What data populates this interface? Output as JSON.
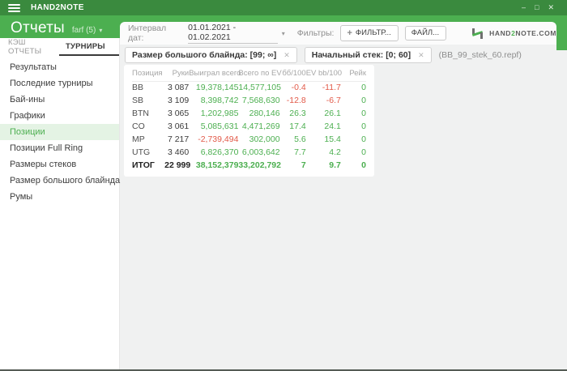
{
  "app": {
    "name": "HAND2NOTE"
  },
  "icons": {
    "minimize": "–",
    "maximize": "□",
    "close": "✕",
    "caret_down": "▾",
    "plus": "+",
    "chip_close": "✕"
  },
  "header": {
    "title": "Отчеты",
    "account": "farf (5)"
  },
  "tabs": {
    "cash": "КЭШ ОТЧЕТЫ",
    "tournaments": "ТУРНИРЫ"
  },
  "sidebar": {
    "items": [
      {
        "label": "Результаты"
      },
      {
        "label": "Последние турниры"
      },
      {
        "label": "Бай-ины"
      },
      {
        "label": "Графики"
      },
      {
        "label": "Позиции",
        "active": true
      },
      {
        "label": "Позиции Full Ring"
      },
      {
        "label": "Размеры стеков"
      },
      {
        "label": "Размер большого блайнда"
      },
      {
        "label": "Румы"
      }
    ]
  },
  "toolbar": {
    "date_label": "Интервал дат:",
    "date_range": "01.01.2021 - 01.02.2021",
    "filters_label": "Фильтры:",
    "filter_button": "ФИЛЬТР...",
    "file_button": "ФАЙЛ...",
    "brand": {
      "part1": "HAND",
      "part2": "2",
      "part3": "NOTE.COM"
    }
  },
  "filters": {
    "chip1": "Размер большого блайнда: [99; ∞]",
    "chip2": "Начальный стек: [0; 60]",
    "file_note": "(BB_99_stek_60.repf)"
  },
  "table": {
    "headers": {
      "position": "Позиция",
      "hands": "Руки",
      "won": "Выиграл всего",
      "ev": "Всего по EV",
      "bb100": "бб/100",
      "evbb100": "EV bb/100",
      "rake": "Рейк"
    },
    "rows": [
      {
        "position": "BB",
        "hands": "3 087",
        "won": "19,378,145",
        "ev": "14,577,105",
        "bb100": "-0.4",
        "evbb100": "-11.7",
        "rake": "0"
      },
      {
        "position": "SB",
        "hands": "3 109",
        "won": "8,398,742",
        "ev": "7,568,630",
        "bb100": "-12.8",
        "evbb100": "-6.7",
        "rake": "0"
      },
      {
        "position": "BTN",
        "hands": "3 065",
        "won": "1,202,985",
        "ev": "280,146",
        "bb100": "26.3",
        "evbb100": "26.1",
        "rake": "0"
      },
      {
        "position": "CO",
        "hands": "3 061",
        "won": "5,085,631",
        "ev": "4,471,269",
        "bb100": "17.4",
        "evbb100": "24.1",
        "rake": "0"
      },
      {
        "position": "MP",
        "hands": "7 217",
        "won": "-2,739,494",
        "ev": "302,000",
        "bb100": "5.6",
        "evbb100": "15.4",
        "rake": "0"
      },
      {
        "position": "UTG",
        "hands": "3 460",
        "won": "6,826,370",
        "ev": "6,003,642",
        "bb100": "7.7",
        "evbb100": "4.2",
        "rake": "0"
      },
      {
        "position": "ИТОГ",
        "hands": "22 999",
        "won": "38,152,379",
        "ev": "33,202,792",
        "bb100": "7",
        "evbb100": "9.7",
        "rake": "0"
      }
    ]
  },
  "colors": {
    "titlebar_green": "#3a8a3e",
    "accent_green": "#4caf50",
    "negative_red": "#e25a49",
    "active_item_bg": "#e4f3e4"
  }
}
